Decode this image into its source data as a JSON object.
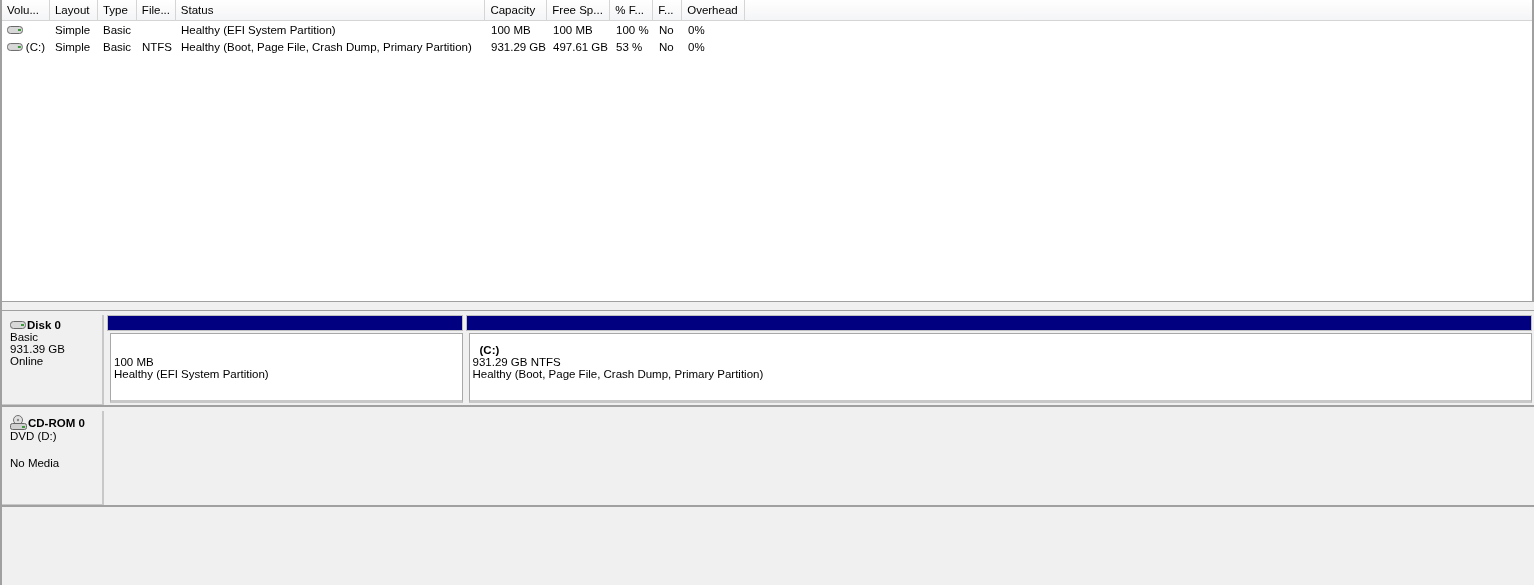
{
  "volume_list": {
    "columns": [
      "Volu...",
      "Layout",
      "Type",
      "File...",
      "Status",
      "Capacity",
      "Free Sp...",
      "% F...",
      "F...",
      "Overhead"
    ],
    "rows": [
      {
        "cells": [
          null,
          "Simple",
          "Basic",
          null,
          "Healthy (EFI System Partition)",
          "100 MB",
          "100 MB",
          "100 %",
          "No",
          "0%"
        ]
      },
      {
        "cells": [
          "(C:)",
          "Simple",
          "Basic",
          "NTFS",
          "Healthy (Boot, Page File, Crash Dump, Primary Partition)",
          "931.29 GB",
          "497.61 GB",
          "53 %",
          "No",
          "0%"
        ]
      }
    ]
  },
  "disks": [
    {
      "kind": "disk",
      "name": "Disk 0",
      "type": "Basic",
      "size": "931.39 GB",
      "status": "Online",
      "partitions": [
        {
          "size": "100 MB",
          "health": "Healthy (EFI System Partition)"
        },
        {
          "label": "(C:)",
          "size": "931.29 GB NTFS",
          "health": "Healthy (Boot, Page File, Crash Dump, Primary Partition)"
        }
      ]
    },
    {
      "kind": "cdrom",
      "name": "CD-ROM 0",
      "type": "DVD (D:)",
      "status": "No Media"
    }
  ]
}
